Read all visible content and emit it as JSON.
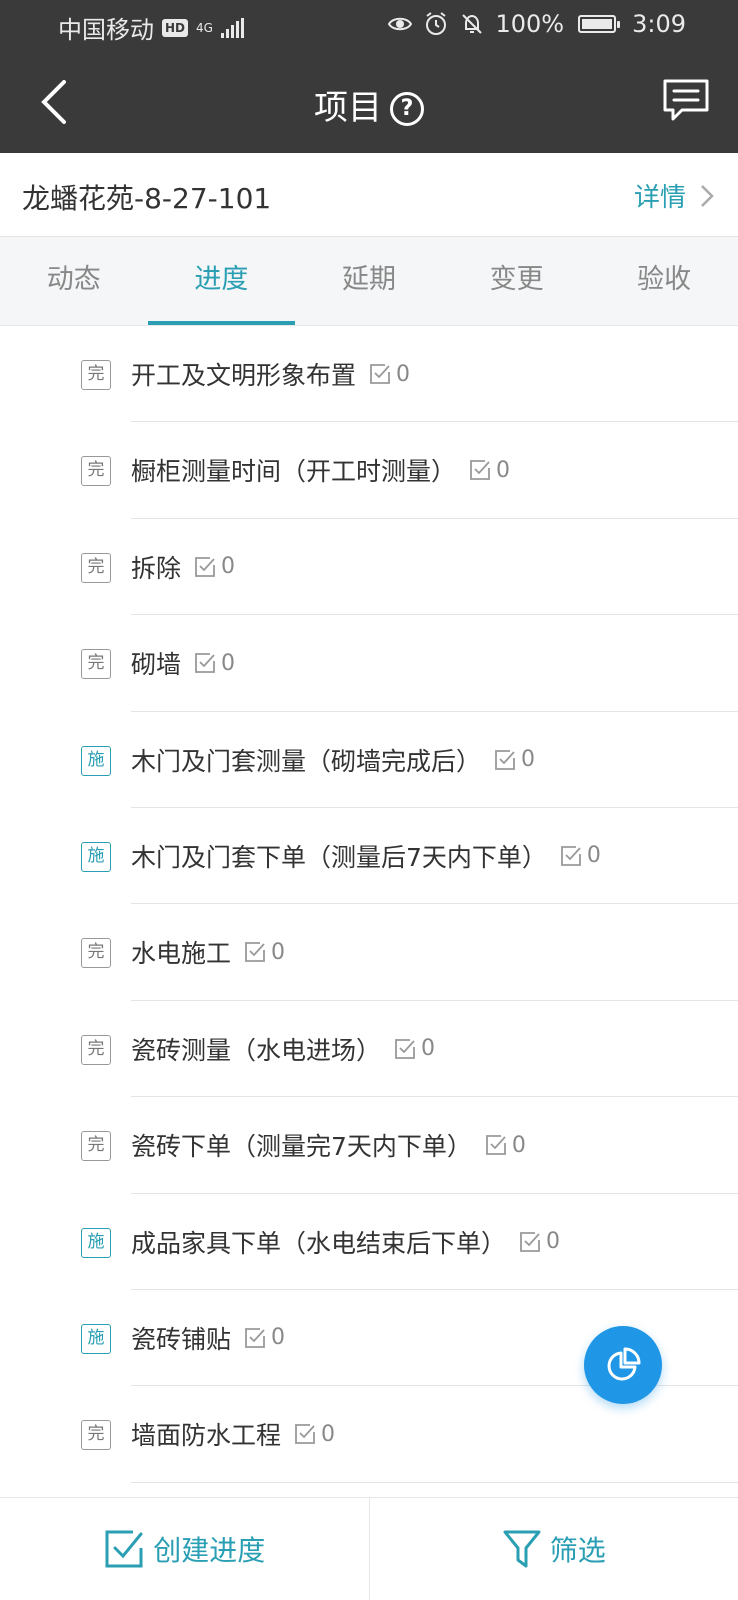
{
  "status_bar": {
    "carrier": "中国移动",
    "hd": "HD",
    "network": "4G",
    "battery": "100%",
    "time": "3:09"
  },
  "nav": {
    "title": "项目",
    "help_glyph": "?"
  },
  "project": {
    "name": "龙蟠花苑-8-27-101",
    "detail_label": "详情"
  },
  "tabs": [
    {
      "label": "动态",
      "active": false
    },
    {
      "label": "进度",
      "active": true
    },
    {
      "label": "延期",
      "active": false
    },
    {
      "label": "变更",
      "active": false
    },
    {
      "label": "验收",
      "active": false
    }
  ],
  "items": [
    {
      "status": "完",
      "title": "开工及文明形象布置",
      "count": "0"
    },
    {
      "status": "完",
      "title": "橱柜测量时间（开工时测量）",
      "count": "0"
    },
    {
      "status": "完",
      "title": "拆除",
      "count": "0"
    },
    {
      "status": "完",
      "title": "砌墙",
      "count": "0"
    },
    {
      "status": "施",
      "title": "木门及门套测量（砌墙完成后）",
      "count": "0"
    },
    {
      "status": "施",
      "title": "木门及门套下单（测量后7天内下单）",
      "count": "0"
    },
    {
      "status": "完",
      "title": "水电施工",
      "count": "0"
    },
    {
      "status": "完",
      "title": "瓷砖测量（水电进场）",
      "count": "0"
    },
    {
      "status": "完",
      "title": "瓷砖下单（测量完7天内下单）",
      "count": "0"
    },
    {
      "status": "施",
      "title": "成品家具下单（水电结束后下单）",
      "count": "0"
    },
    {
      "status": "施",
      "title": "瓷砖铺贴",
      "count": "0"
    },
    {
      "status": "完",
      "title": "墙面防水工程",
      "count": "0"
    }
  ],
  "bottom": {
    "create_label": "创建进度",
    "filter_label": "筛选"
  },
  "colors": {
    "accent": "#2a9fb4",
    "fab": "#1f96e6",
    "topbar": "#3a3a3a"
  }
}
